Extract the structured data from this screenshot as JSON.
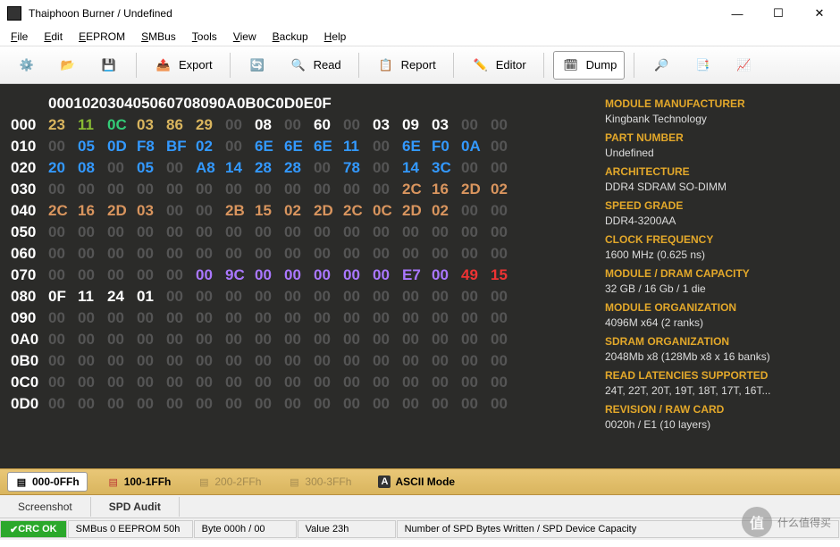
{
  "window": {
    "title": "Thaiphoon Burner / Undefined"
  },
  "menu": {
    "file": "File",
    "edit": "Edit",
    "eeprom": "EEPROM",
    "smbus": "SMBus",
    "tools": "Tools",
    "view": "View",
    "backup": "Backup",
    "help": "Help"
  },
  "tool": {
    "export": "Export",
    "read": "Read",
    "report": "Report",
    "editor": "Editor",
    "dump": "Dump"
  },
  "hex": {
    "header": [
      "00",
      "01",
      "02",
      "03",
      "04",
      "05",
      "06",
      "07",
      "08",
      "09",
      "0A",
      "0B",
      "0C",
      "0D",
      "0E",
      "0F"
    ],
    "rows": [
      {
        "a": "000",
        "c": [
          [
            "23",
            "#d9b55e"
          ],
          [
            "11",
            "#8b3"
          ],
          [
            "0C",
            "#3c7"
          ],
          [
            "03",
            "#d9b55e"
          ],
          [
            "86",
            "#d9b55e"
          ],
          [
            "29",
            "#d9b55e"
          ],
          [
            "00",
            ""
          ],
          [
            "08",
            "#fff"
          ],
          [
            "00",
            ""
          ],
          [
            "60",
            "#fff"
          ],
          [
            "00",
            ""
          ],
          [
            "03",
            "#fff"
          ],
          [
            "09",
            "#fff"
          ],
          [
            "03",
            "#fff"
          ],
          [
            "00",
            ""
          ],
          [
            "00",
            ""
          ]
        ]
      },
      {
        "a": "010",
        "c": [
          [
            "00",
            ""
          ],
          [
            "05",
            "#39f"
          ],
          [
            "0D",
            "#39f"
          ],
          [
            "F8",
            "#39f"
          ],
          [
            "BF",
            "#39f"
          ],
          [
            "02",
            "#39f"
          ],
          [
            "00",
            ""
          ],
          [
            "6E",
            "#39f"
          ],
          [
            "6E",
            "#39f"
          ],
          [
            "6E",
            "#39f"
          ],
          [
            "11",
            "#39f"
          ],
          [
            "00",
            ""
          ],
          [
            "6E",
            "#39f"
          ],
          [
            "F0",
            "#39f"
          ],
          [
            "0A",
            "#39f"
          ],
          [
            "00",
            ""
          ]
        ]
      },
      {
        "a": "020",
        "c": [
          [
            "20",
            "#39f"
          ],
          [
            "08",
            "#39f"
          ],
          [
            "00",
            ""
          ],
          [
            "05",
            "#39f"
          ],
          [
            "00",
            ""
          ],
          [
            "A8",
            "#39f"
          ],
          [
            "14",
            "#39f"
          ],
          [
            "28",
            "#39f"
          ],
          [
            "28",
            "#39f"
          ],
          [
            "00",
            ""
          ],
          [
            "78",
            "#39f"
          ],
          [
            "00",
            ""
          ],
          [
            "14",
            "#39f"
          ],
          [
            "3C",
            "#39f"
          ],
          [
            "00",
            ""
          ],
          [
            "00",
            ""
          ]
        ]
      },
      {
        "a": "030",
        "c": [
          [
            "00",
            ""
          ],
          [
            "00",
            ""
          ],
          [
            "00",
            ""
          ],
          [
            "00",
            ""
          ],
          [
            "00",
            ""
          ],
          [
            "00",
            ""
          ],
          [
            "00",
            ""
          ],
          [
            "00",
            ""
          ],
          [
            "00",
            ""
          ],
          [
            "00",
            ""
          ],
          [
            "00",
            ""
          ],
          [
            "00",
            ""
          ],
          [
            "2C",
            "#d9955e"
          ],
          [
            "16",
            "#d9955e"
          ],
          [
            "2D",
            "#d9955e"
          ],
          [
            "02",
            "#d9955e"
          ]
        ]
      },
      {
        "a": "040",
        "c": [
          [
            "2C",
            "#d9955e"
          ],
          [
            "16",
            "#d9955e"
          ],
          [
            "2D",
            "#d9955e"
          ],
          [
            "03",
            "#d9955e"
          ],
          [
            "00",
            ""
          ],
          [
            "00",
            ""
          ],
          [
            "2B",
            "#d9955e"
          ],
          [
            "15",
            "#d9955e"
          ],
          [
            "02",
            "#d9955e"
          ],
          [
            "2D",
            "#d9955e"
          ],
          [
            "2C",
            "#d9955e"
          ],
          [
            "0C",
            "#d9955e"
          ],
          [
            "2D",
            "#d9955e"
          ],
          [
            "02",
            "#d9955e"
          ],
          [
            "00",
            ""
          ],
          [
            "00",
            ""
          ]
        ]
      },
      {
        "a": "050",
        "c": [
          [
            "00",
            ""
          ],
          [
            "00",
            ""
          ],
          [
            "00",
            ""
          ],
          [
            "00",
            ""
          ],
          [
            "00",
            ""
          ],
          [
            "00",
            ""
          ],
          [
            "00",
            ""
          ],
          [
            "00",
            ""
          ],
          [
            "00",
            ""
          ],
          [
            "00",
            ""
          ],
          [
            "00",
            ""
          ],
          [
            "00",
            ""
          ],
          [
            "00",
            ""
          ],
          [
            "00",
            ""
          ],
          [
            "00",
            ""
          ],
          [
            "00",
            ""
          ]
        ]
      },
      {
        "a": "060",
        "c": [
          [
            "00",
            ""
          ],
          [
            "00",
            ""
          ],
          [
            "00",
            ""
          ],
          [
            "00",
            ""
          ],
          [
            "00",
            ""
          ],
          [
            "00",
            ""
          ],
          [
            "00",
            ""
          ],
          [
            "00",
            ""
          ],
          [
            "00",
            ""
          ],
          [
            "00",
            ""
          ],
          [
            "00",
            ""
          ],
          [
            "00",
            ""
          ],
          [
            "00",
            ""
          ],
          [
            "00",
            ""
          ],
          [
            "00",
            ""
          ],
          [
            "00",
            ""
          ]
        ]
      },
      {
        "a": "070",
        "c": [
          [
            "00",
            ""
          ],
          [
            "00",
            ""
          ],
          [
            "00",
            ""
          ],
          [
            "00",
            ""
          ],
          [
            "00",
            ""
          ],
          [
            "00",
            "#a7f"
          ],
          [
            "9C",
            "#a7f"
          ],
          [
            "00",
            "#a7f"
          ],
          [
            "00",
            "#a7f"
          ],
          [
            "00",
            "#a7f"
          ],
          [
            "00",
            "#a7f"
          ],
          [
            "00",
            "#a7f"
          ],
          [
            "E7",
            "#a7f"
          ],
          [
            "00",
            "#a7f"
          ],
          [
            "49",
            "#e33"
          ],
          [
            "15",
            "#e33"
          ]
        ]
      },
      {
        "a": "080",
        "c": [
          [
            "0F",
            "#fff"
          ],
          [
            "11",
            "#fff"
          ],
          [
            "24",
            "#fff"
          ],
          [
            "01",
            "#fff"
          ],
          [
            "00",
            ""
          ],
          [
            "00",
            ""
          ],
          [
            "00",
            ""
          ],
          [
            "00",
            ""
          ],
          [
            "00",
            ""
          ],
          [
            "00",
            ""
          ],
          [
            "00",
            ""
          ],
          [
            "00",
            ""
          ],
          [
            "00",
            ""
          ],
          [
            "00",
            ""
          ],
          [
            "00",
            ""
          ],
          [
            "00",
            ""
          ]
        ]
      },
      {
        "a": "090",
        "c": [
          [
            "00",
            ""
          ],
          [
            "00",
            ""
          ],
          [
            "00",
            ""
          ],
          [
            "00",
            ""
          ],
          [
            "00",
            ""
          ],
          [
            "00",
            ""
          ],
          [
            "00",
            ""
          ],
          [
            "00",
            ""
          ],
          [
            "00",
            ""
          ],
          [
            "00",
            ""
          ],
          [
            "00",
            ""
          ],
          [
            "00",
            ""
          ],
          [
            "00",
            ""
          ],
          [
            "00",
            ""
          ],
          [
            "00",
            ""
          ],
          [
            "00",
            ""
          ]
        ]
      },
      {
        "a": "0A0",
        "c": [
          [
            "00",
            ""
          ],
          [
            "00",
            ""
          ],
          [
            "00",
            ""
          ],
          [
            "00",
            ""
          ],
          [
            "00",
            ""
          ],
          [
            "00",
            ""
          ],
          [
            "00",
            ""
          ],
          [
            "00",
            ""
          ],
          [
            "00",
            ""
          ],
          [
            "00",
            ""
          ],
          [
            "00",
            ""
          ],
          [
            "00",
            ""
          ],
          [
            "00",
            ""
          ],
          [
            "00",
            ""
          ],
          [
            "00",
            ""
          ],
          [
            "00",
            ""
          ]
        ]
      },
      {
        "a": "0B0",
        "c": [
          [
            "00",
            ""
          ],
          [
            "00",
            ""
          ],
          [
            "00",
            ""
          ],
          [
            "00",
            ""
          ],
          [
            "00",
            ""
          ],
          [
            "00",
            ""
          ],
          [
            "00",
            ""
          ],
          [
            "00",
            ""
          ],
          [
            "00",
            ""
          ],
          [
            "00",
            ""
          ],
          [
            "00",
            ""
          ],
          [
            "00",
            ""
          ],
          [
            "00",
            ""
          ],
          [
            "00",
            ""
          ],
          [
            "00",
            ""
          ],
          [
            "00",
            ""
          ]
        ]
      },
      {
        "a": "0C0",
        "c": [
          [
            "00",
            ""
          ],
          [
            "00",
            ""
          ],
          [
            "00",
            ""
          ],
          [
            "00",
            ""
          ],
          [
            "00",
            ""
          ],
          [
            "00",
            ""
          ],
          [
            "00",
            ""
          ],
          [
            "00",
            ""
          ],
          [
            "00",
            ""
          ],
          [
            "00",
            ""
          ],
          [
            "00",
            ""
          ],
          [
            "00",
            ""
          ],
          [
            "00",
            ""
          ],
          [
            "00",
            ""
          ],
          [
            "00",
            ""
          ],
          [
            "00",
            ""
          ]
        ]
      },
      {
        "a": "0D0",
        "c": [
          [
            "00",
            ""
          ],
          [
            "00",
            ""
          ],
          [
            "00",
            ""
          ],
          [
            "00",
            ""
          ],
          [
            "00",
            ""
          ],
          [
            "00",
            ""
          ],
          [
            "00",
            ""
          ],
          [
            "00",
            ""
          ],
          [
            "00",
            ""
          ],
          [
            "00",
            ""
          ],
          [
            "00",
            ""
          ],
          [
            "00",
            ""
          ],
          [
            "00",
            ""
          ],
          [
            "00",
            ""
          ],
          [
            "00",
            ""
          ],
          [
            "00",
            ""
          ]
        ]
      }
    ]
  },
  "info": [
    {
      "l": "MODULE MANUFACTURER",
      "v": "Kingbank Technology"
    },
    {
      "l": "PART NUMBER",
      "v": "Undefined"
    },
    {
      "l": "ARCHITECTURE",
      "v": "DDR4 SDRAM SO-DIMM"
    },
    {
      "l": "SPEED GRADE",
      "v": "DDR4-3200AA"
    },
    {
      "l": "CLOCK FREQUENCY",
      "v": "1600 MHz (0.625 ns)"
    },
    {
      "l": "MODULE / DRAM CAPACITY",
      "v": "32 GB / 16 Gb  / 1 die"
    },
    {
      "l": "MODULE ORGANIZATION",
      "v": "4096M x64 (2 ranks)"
    },
    {
      "l": "SDRAM ORGANIZATION",
      "v": "2048Mb x8 (128Mb x8 x 16 banks)"
    },
    {
      "l": "READ LATENCIES SUPPORTED",
      "v": "24T, 22T, 20T, 19T, 18T, 17T, 16T..."
    },
    {
      "l": "REVISION / RAW CARD",
      "v": "0020h / E1 (10 layers)"
    }
  ],
  "tabs": {
    "t0": "000-0FFh",
    "t1": "100-1FFh",
    "t2": "200-2FFh",
    "t3": "300-3FFh",
    "ascii": "ASCII Mode"
  },
  "subtabs": {
    "screenshot": "Screenshot",
    "spdaudit": "SPD Audit"
  },
  "status": {
    "crc": "CRC OK",
    "bus": "SMBus 0 EEPROM 50h",
    "byte": "Byte 000h / 00",
    "val": "Value 23h",
    "desc": "Number of SPD Bytes Written / SPD Device Capacity"
  },
  "watermark": "什么值得买"
}
